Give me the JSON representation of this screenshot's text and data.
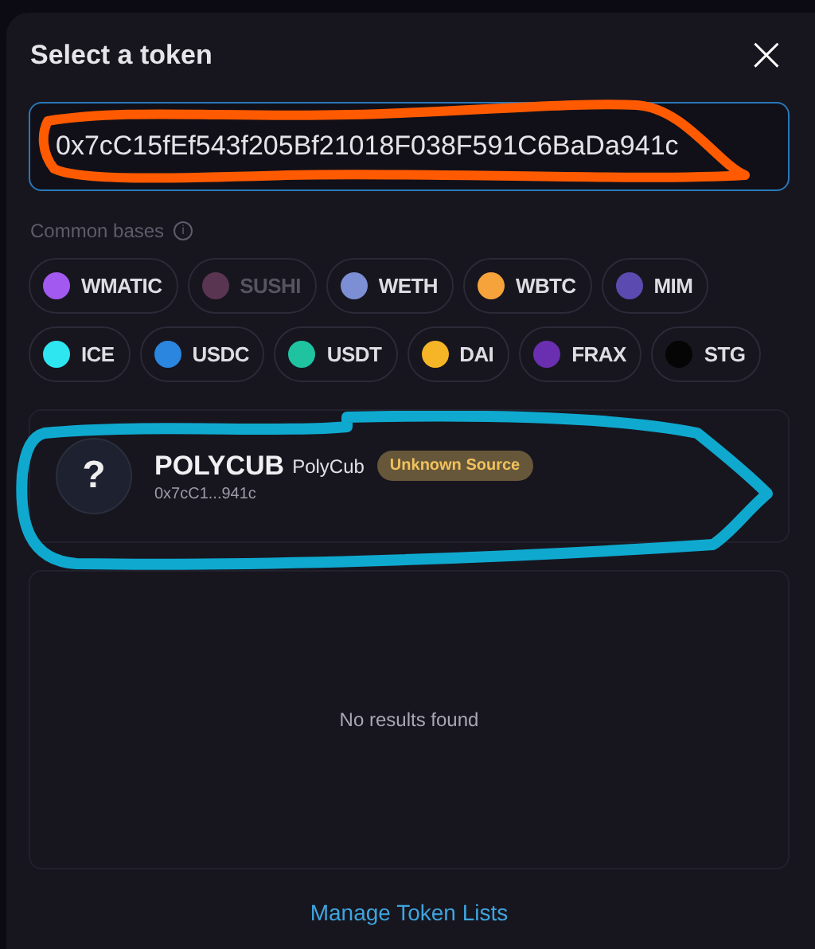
{
  "dialog": {
    "title": "Select a token",
    "close": "×"
  },
  "search": {
    "value": "0x7cC15fEf543f205Bf21018F038F591C6BaDa941c"
  },
  "common_bases": {
    "label": "Common bases",
    "info": "i",
    "tokens": [
      {
        "symbol": "WMATIC",
        "color": "#a259f0",
        "disabled": false
      },
      {
        "symbol": "SUSHI",
        "color": "#5a3552",
        "disabled": true
      },
      {
        "symbol": "WETH",
        "color": "#7c8fd4",
        "disabled": false
      },
      {
        "symbol": "WBTC",
        "color": "#f7a33b",
        "disabled": false
      },
      {
        "symbol": "MIM",
        "color": "#5b4bb0",
        "disabled": false
      },
      {
        "symbol": "ICE",
        "color": "#2ee6f0",
        "disabled": false
      },
      {
        "symbol": "USDC",
        "color": "#2b86e0",
        "disabled": false
      },
      {
        "symbol": "USDT",
        "color": "#1fc3a0",
        "disabled": false
      },
      {
        "symbol": "DAI",
        "color": "#f5b526",
        "disabled": false
      },
      {
        "symbol": "FRAX",
        "color": "#6a2fb0",
        "disabled": false
      },
      {
        "symbol": "STG",
        "color": "#050505",
        "disabled": false
      }
    ]
  },
  "result": {
    "icon": "?",
    "symbol": "POLYCUB",
    "name": "PolyCub",
    "badge": "Unknown Source",
    "address": "0x7cC1...941c"
  },
  "empty_message": "No results found",
  "footer_link": "Manage Token Lists"
}
